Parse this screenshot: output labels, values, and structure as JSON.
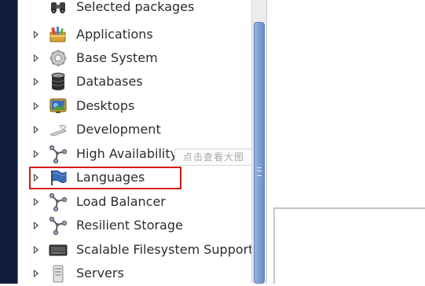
{
  "tree": {
    "selected_packages_label": "Selected packages",
    "items": [
      {
        "label": "Applications",
        "icon": "applications-icon"
      },
      {
        "label": "Base System",
        "icon": "gear-icon"
      },
      {
        "label": "Databases",
        "icon": "database-icon"
      },
      {
        "label": "Desktops",
        "icon": "desktop-icon"
      },
      {
        "label": "Development",
        "icon": "development-icon"
      },
      {
        "label": "High Availability",
        "icon": "cluster-icon"
      },
      {
        "label": "Languages",
        "icon": "flag-icon"
      },
      {
        "label": "Load Balancer",
        "icon": "cluster-icon"
      },
      {
        "label": "Resilient Storage",
        "icon": "cluster-icon"
      },
      {
        "label": "Scalable Filesystem Support",
        "icon": "harddisk-icon"
      },
      {
        "label": "Servers",
        "icon": "server-icon"
      }
    ]
  },
  "tooltip": {
    "text": "点击查看大图"
  },
  "colors": {
    "highlight": "#d11a1a",
    "scroll_thumb": "#7d9fd6",
    "left_edge": "#0f1c3e"
  }
}
